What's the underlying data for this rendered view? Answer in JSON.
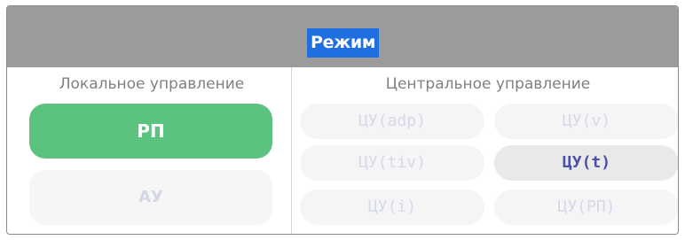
{
  "header": {
    "title": "Режим"
  },
  "local_control": {
    "title": "Локальное управление",
    "buttons": [
      {
        "label": "РП",
        "state": "active"
      },
      {
        "label": "АУ",
        "state": "inactive"
      }
    ]
  },
  "central_control": {
    "title": "Центральное управление",
    "buttons": [
      {
        "label": "ЦУ(adp)",
        "state": "inactive"
      },
      {
        "label": "ЦУ(v)",
        "state": "inactive"
      },
      {
        "label": "ЦУ(tiv)",
        "state": "inactive"
      },
      {
        "label": "ЦУ(t)",
        "state": "active"
      },
      {
        "label": "ЦУ(i)",
        "state": "inactive"
      },
      {
        "label": "ЦУ(РП)",
        "state": "inactive"
      }
    ]
  },
  "colors": {
    "header_bg": "#9b9b9b",
    "title_highlight": "#1f6fe0",
    "active_green": "#5cc27f",
    "active_text": "#4a4fa8",
    "inactive_bg": "#f5f5f5",
    "inactive_text": "#d6d8ec"
  }
}
